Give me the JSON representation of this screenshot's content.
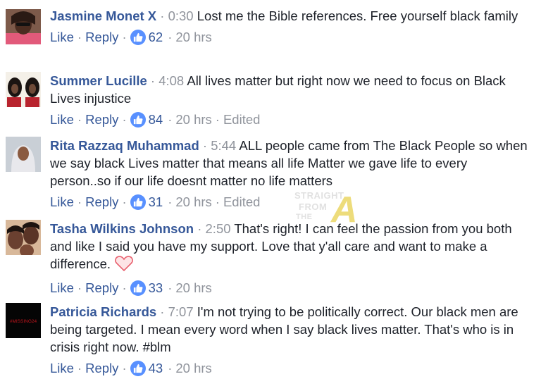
{
  "comments": [
    {
      "author": "Jasmine Monet X",
      "time": "0:30",
      "text": "Lost me the Bible references. Free yourself black family",
      "like_label": "Like",
      "reply_label": "Reply",
      "likes": "62",
      "age": "20 hrs",
      "edited": ""
    },
    {
      "author": "Summer Lucille",
      "time": "4:08",
      "text": "All lives matter but right now we need to focus on Black Lives injustice",
      "like_label": "Like",
      "reply_label": "Reply",
      "likes": "84",
      "age": "20 hrs",
      "edited": "Edited"
    },
    {
      "author": "Rita Razzaq Muhammad",
      "time": "5:44",
      "text": "ALL people came from The Black People so when we say black Lives matter that means all life Matter we gave life to every person..so if our life doesnt matter no life matters",
      "like_label": "Like",
      "reply_label": "Reply",
      "likes": "31",
      "age": "20 hrs",
      "edited": "Edited"
    },
    {
      "author": "Tasha Wilkins Johnson",
      "time": "2:50",
      "text": "That's right! I can feel the passion from you both and like I said you have my support. Love that y'all care and want to make a difference.",
      "like_label": "Like",
      "reply_label": "Reply",
      "likes": "33",
      "age": "20 hrs",
      "edited": ""
    },
    {
      "author": "Patricia Richards",
      "time": "7:07",
      "text": "I'm not trying to be politically correct. Our black men are being targeted. I mean every word when I say black lives matter. That's who is in crisis right now. #blm",
      "like_label": "Like",
      "reply_label": "Reply",
      "likes": "43",
      "age": "20 hrs",
      "edited": ""
    }
  ],
  "separator": "·",
  "watermark": {
    "line1": "STRAIGHT",
    "line2": "FROM",
    "line3": "THE",
    "letter": "A"
  },
  "avatar5_text": "#MISSING24",
  "colors": {
    "author": "#365899",
    "meta": "#90949c",
    "like_badge": "#5890ff",
    "text": "#1d2129"
  },
  "icons": {
    "like_badge": "thumbs-up-icon",
    "heart": "heart-icon"
  }
}
